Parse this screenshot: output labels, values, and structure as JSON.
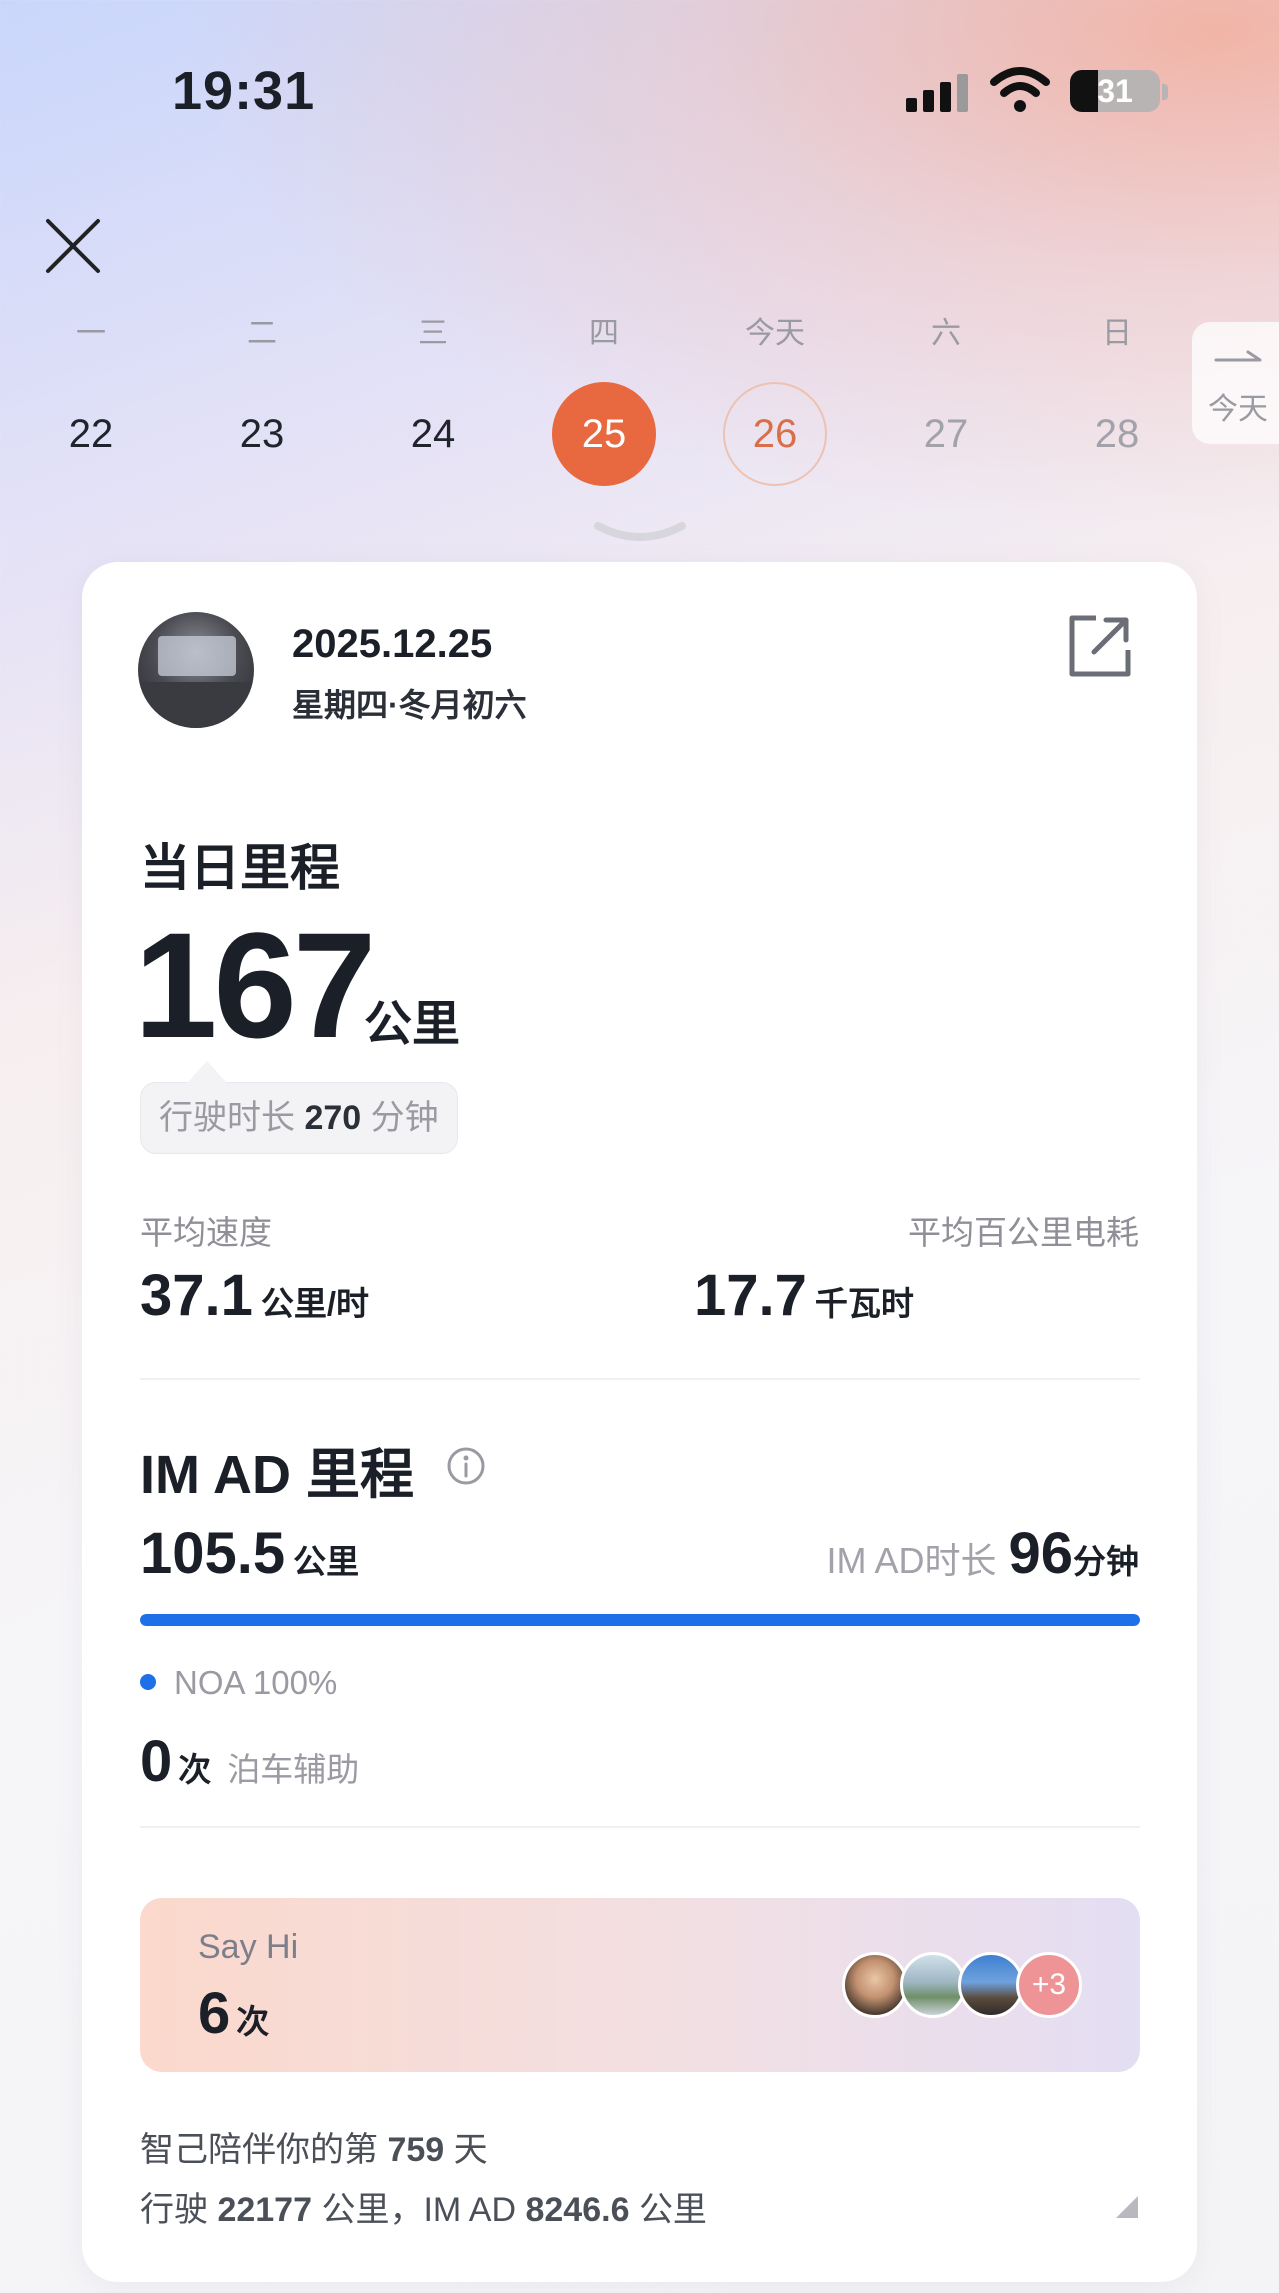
{
  "status_bar": {
    "time": "19:31",
    "battery": "31",
    "battery_level": 0.31
  },
  "calendar": {
    "days": [
      {
        "weekday": "一",
        "date": "22",
        "state": "past"
      },
      {
        "weekday": "二",
        "date": "23",
        "state": "past"
      },
      {
        "weekday": "三",
        "date": "24",
        "state": "past"
      },
      {
        "weekday": "四",
        "date": "25",
        "state": "selected"
      },
      {
        "weekday": "今天",
        "date": "26",
        "state": "today"
      },
      {
        "weekday": "六",
        "date": "27",
        "state": "future"
      },
      {
        "weekday": "日",
        "date": "28",
        "state": "future"
      }
    ],
    "today_button": "今天"
  },
  "card": {
    "date": "2025.12.25",
    "date_sub": "星期四·冬月初六",
    "daily_mileage_label": "当日里程",
    "daily_mileage_value": "167",
    "daily_mileage_unit": "公里",
    "duration_prefix": "行驶时长",
    "duration_value": "270",
    "duration_unit": "分钟",
    "avg_speed_label": "平均速度",
    "avg_speed_value": "37.1",
    "avg_speed_unit": "公里/时",
    "avg_energy_label": "平均百公里电耗",
    "avg_energy_value": "17.7",
    "avg_energy_unit": "千瓦时",
    "imad_title": "IM AD 里程",
    "imad_value": "105.5",
    "imad_unit": "公里",
    "imad_duration_label": "IM AD时长",
    "imad_duration_value": "96",
    "imad_duration_unit": "分钟",
    "imad_progress": 1.0,
    "noa_text": "NOA 100%",
    "parking_count": "0",
    "parking_unit": "次",
    "parking_label": "泊车辅助",
    "sayhi_label": "Say Hi",
    "sayhi_count": "6",
    "sayhi_unit": "次",
    "sayhi_more": "+3",
    "footer_prefix": "智己陪伴你的第",
    "footer_days": "759",
    "footer_days_unit": "天",
    "footer_drive_prefix": "行驶",
    "footer_drive_value": "22177",
    "footer_drive_unit": "公里，IM AD",
    "footer_imad_value": "8246.6",
    "footer_imad_unit": "公里"
  },
  "colors": {
    "accent": "#e8683f",
    "progress_blue": "#1f6fe8"
  }
}
